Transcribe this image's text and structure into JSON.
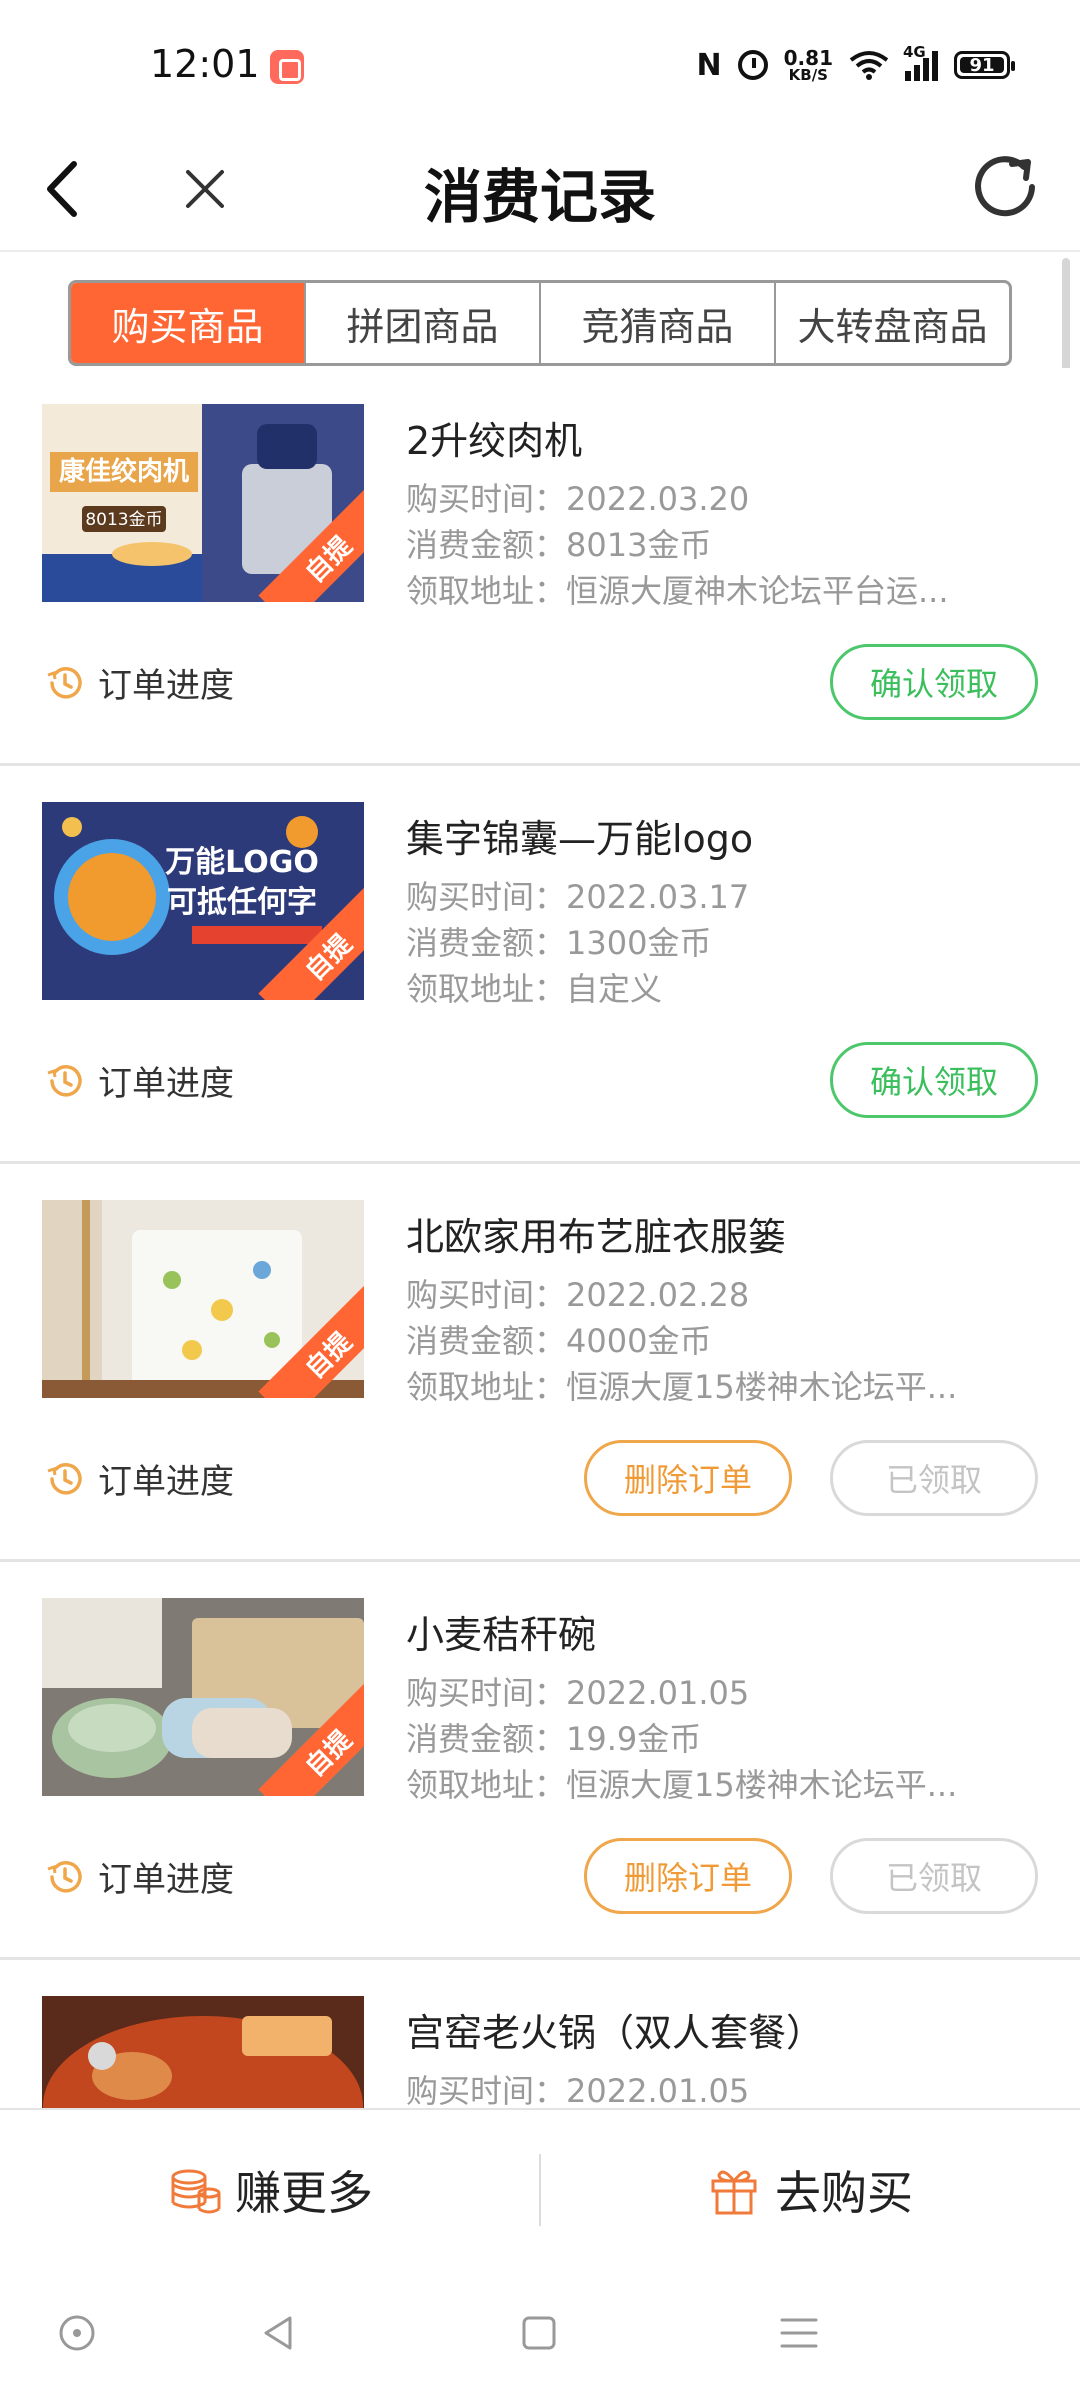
{
  "status_bar": {
    "time": "12:01",
    "speed_value": "0.81",
    "speed_unit": "KB/S",
    "network": "4G",
    "battery": "91",
    "nfc": "N"
  },
  "header": {
    "title": "消费记录"
  },
  "tabs": [
    {
      "label": "购买商品",
      "active": true
    },
    {
      "label": "拼团商品",
      "active": false
    },
    {
      "label": "竞猜商品",
      "active": false
    },
    {
      "label": "大转盘商品",
      "active": false
    }
  ],
  "orders": [
    {
      "title": "2升绞肉机",
      "time": "购买时间：2022.03.20",
      "amount": "消费金额：8013金币",
      "address": "领取地址：恒源大厦神木论坛平台运...",
      "badge": "自提",
      "thumb_text_1": "康佳绞肉机",
      "thumb_text_2": "8013金币",
      "progress_label": "订单进度",
      "button_primary": "确认领取"
    },
    {
      "title": "集字锦囊—万能logo",
      "time": "购买时间：2022.03.17",
      "amount": "消费金额：1300金币",
      "address": "领取地址：自定义",
      "badge": "自提",
      "thumb_text_1": "万能LOGO",
      "thumb_text_2": "可抵任何字",
      "progress_label": "订单进度",
      "button_primary": "确认领取"
    },
    {
      "title": "北欧家用布艺脏衣服篓",
      "time": "购买时间：2022.02.28",
      "amount": "消费金额：4000金币",
      "address": "领取地址：恒源大厦15楼神木论坛平...",
      "badge": "自提",
      "progress_label": "订单进度",
      "button_delete": "删除订单",
      "button_done": "已领取"
    },
    {
      "title": "小麦秸秆碗",
      "time": "购买时间：2022.01.05",
      "amount": "消费金额：19.9金币",
      "address": "领取地址：恒源大厦15楼神木论坛平...",
      "badge": "自提",
      "progress_label": "订单进度",
      "button_delete": "删除订单",
      "button_done": "已领取"
    },
    {
      "title": "宫窑老火锅（双人套餐）",
      "time": "购买时间：2022.01.05"
    }
  ],
  "bottom_bar": {
    "earn_label": "赚更多",
    "buy_label": "去购买"
  },
  "colors": {
    "accent": "#ff6633",
    "confirm_green": "#3bbf5d",
    "delete_orange": "#f09a35"
  }
}
